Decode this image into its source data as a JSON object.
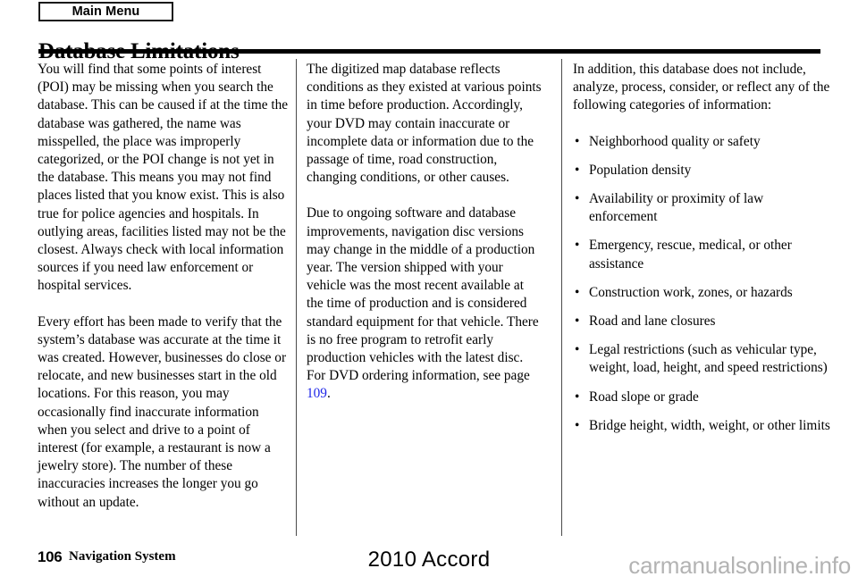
{
  "header": {
    "main_menu_label": "Main Menu",
    "title": "Database Limitations"
  },
  "columns": {
    "left": {
      "paragraphs": [
        "You will find that some points of interest (POI) may be missing when you search the database. This can be caused if at the time the database was gathered, the name was misspelled, the place was improperly categorized, or the POI change is not yet in the database. This means you may not find places listed that you know exist. This is also true for police agencies and hospitals. In outlying areas, facilities listed may not be the closest. Always check with local information sources if you need law enforcement or hospital services.",
        "Every effort has been made to verify that the system’s database was accurate at the time it was created. However, businesses do close or relocate, and new businesses start in the old locations. For this reason, you may occasionally find inaccurate information when you select and drive to a point of interest (for example, a restaurant is now a jewelry store). The number of these inaccuracies increases the longer you go without an update."
      ]
    },
    "middle": {
      "paragraph_1": "The digitized map database reflects conditions as they existed at various points in time before production. Accordingly, your DVD may contain inaccurate or incomplete data or information due to the passage of time, road construction, changing conditions, or other causes.",
      "paragraph_2_before_link": "Due to ongoing software and database improvements, navigation disc versions may change in the middle of a production year. The version shipped with your vehicle was the most recent available at the time of production and is considered standard equipment for that vehicle. There is no free program to retrofit early production vehicles with the latest disc. For DVD ordering information, see page ",
      "page_link": "109",
      "paragraph_2_after_link": "."
    },
    "right": {
      "intro": "In addition, this database does not include, analyze, process, consider, or reflect any of the following categories of information:",
      "bullet_glyph": "•",
      "bullets": [
        "Neighborhood quality or safety",
        "Population density",
        "Availability or proximity of law enforcement",
        "Emergency, rescue, medical, or other assistance",
        "Construction work, zones, or hazards",
        "Road and lane closures",
        "Legal restrictions (such as vehicular type, weight, load, height, and speed restrictions)",
        "Road slope or grade",
        "Bridge height, width, weight, or other limits"
      ]
    }
  },
  "footer": {
    "page_number": "106",
    "section_title": "Navigation System",
    "model": "2010 Accord",
    "watermark": "carmanualsonline.info"
  },
  "colors": {
    "link": "#1e26e8",
    "rule": "#000000",
    "watermark": "#b3b3b3",
    "divider": "#4a4a4a"
  }
}
